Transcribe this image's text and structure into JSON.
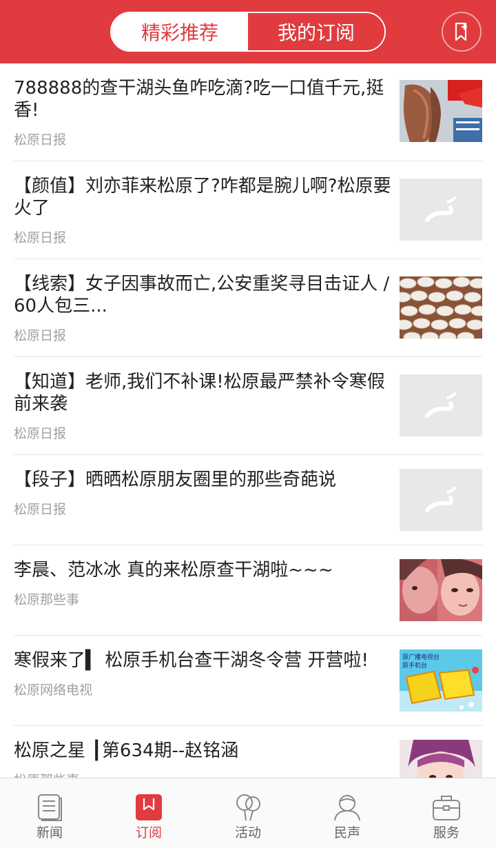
{
  "header": {
    "tabs": [
      {
        "label": "精彩推荐",
        "active": true
      },
      {
        "label": "我的订阅",
        "active": false
      }
    ],
    "right_icon": "bookmark-add-icon"
  },
  "articles": [
    {
      "title": "788888的查干湖头鱼咋吃滴?吃一口值千元,挺香!",
      "source": "松原日报",
      "thumb": "fish-photo"
    },
    {
      "title": "【颜值】刘亦菲来松原了?咋都是腕儿啊?松原要火了",
      "source": "松原日报",
      "thumb": "placeholder"
    },
    {
      "title": "【线索】女子因事故而亡,公安重奖寻目击证人 / 60人包三...",
      "source": "松原日报",
      "thumb": "dumplings-photo"
    },
    {
      "title": "【知道】老师,我们不补课!松原最严禁补令寒假前来袭",
      "source": "松原日报",
      "thumb": "placeholder"
    },
    {
      "title": "【段子】晒晒松原朋友圈里的那些奇葩说",
      "source": "松原日报",
      "thumb": "placeholder"
    },
    {
      "title": "李晨、范冰冰 真的来松原查干湖啦~~~",
      "source": "松原那些事",
      "thumb": "couple-photo"
    },
    {
      "title": "寒假来了▍ 松原手机台查干湖冬令营 开营啦!",
      "source": "松原网络电视",
      "thumb": "winter-camp-banner"
    },
    {
      "title": "松原之星 ┃第634期--赵铭涵",
      "source": "松原那些事",
      "thumb": "portrait-photo"
    }
  ],
  "banner_text": {
    "line1": "原广播电视台",
    "line2": "原手机台"
  },
  "tabbar": [
    {
      "label": "新闻",
      "icon": "news-icon",
      "active": false
    },
    {
      "label": "订阅",
      "icon": "subscribe-icon",
      "active": true
    },
    {
      "label": "活动",
      "icon": "balloons-icon",
      "active": false
    },
    {
      "label": "民声",
      "icon": "person-icon",
      "active": false
    },
    {
      "label": "服务",
      "icon": "briefcase-icon",
      "active": false
    }
  ],
  "colors": {
    "accent": "#e03b3e",
    "text": "#222222",
    "muted": "#a0a0a0",
    "divider": "#e4e4e4"
  }
}
